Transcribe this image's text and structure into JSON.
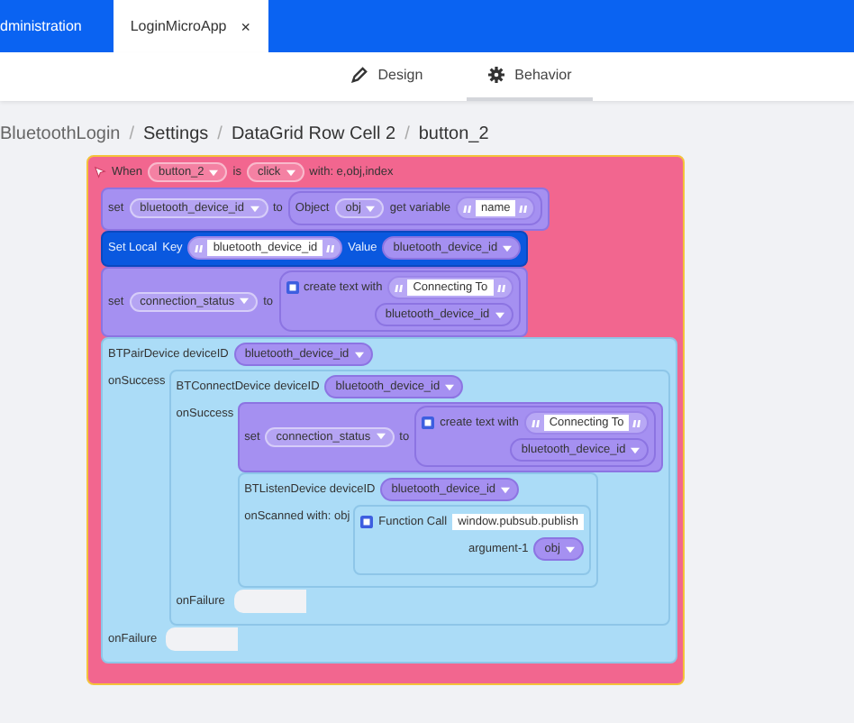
{
  "tabs": [
    {
      "label": "dministration",
      "selected": false
    },
    {
      "label": "LoginMicroApp",
      "selected": true,
      "close": "×"
    }
  ],
  "view_tabs": [
    {
      "label": "Design",
      "selected": false
    },
    {
      "label": "Behavior",
      "selected": true
    }
  ],
  "breadcrumb": {
    "separator": "/",
    "items": [
      "BluetoothLogin",
      "Settings",
      "DataGrid Row Cell 2",
      "button_2"
    ]
  },
  "workspace": {
    "blocks": [
      {
        "kind": "event",
        "selected": true,
        "rows": [
          {
            "parts": [
              {
                "kind": "label",
                "text": "When"
              },
              {
                "kind": "dropdown",
                "text": "button_2"
              },
              {
                "kind": "label",
                "text": "is"
              },
              {
                "kind": "dropdown",
                "text": "click"
              },
              {
                "kind": "label",
                "text": "with: e,obj,index"
              }
            ]
          },
          {
            "body": [
              {
                "kind": "variable",
                "rows": [
                  {
                    "parts": [
                      {
                        "kind": "label",
                        "text": "set"
                      },
                      {
                        "kind": "dropdown",
                        "text": "bluetooth_device_id"
                      },
                      {
                        "kind": "label",
                        "text": "to"
                      },
                      {
                        "kind": "value",
                        "block": {
                          "kind": "variable",
                          "rows": [
                            {
                              "parts": [
                                {
                                  "kind": "label",
                                  "text": "Object"
                                },
                                {
                                  "kind": "dropdown",
                                  "text": "obj"
                                },
                                {
                                  "kind": "label",
                                  "text": "get variable"
                                },
                                {
                                  "kind": "text",
                                  "text": "name"
                                }
                              ]
                            }
                          ]
                        }
                      }
                    ]
                  }
                ]
              },
              {
                "kind": "local",
                "rows": [
                  {
                    "parts": [
                      {
                        "kind": "label",
                        "text": "Set Local"
                      },
                      {
                        "kind": "label",
                        "text": "Key"
                      },
                      {
                        "kind": "text",
                        "text": "bluetooth_device_id"
                      },
                      {
                        "kind": "label",
                        "text": "Value"
                      },
                      {
                        "kind": "getter",
                        "text": "bluetooth_device_id"
                      }
                    ]
                  }
                ]
              },
              {
                "kind": "variable",
                "rows": [
                  {
                    "parts": [
                      {
                        "kind": "label",
                        "text": "set"
                      },
                      {
                        "kind": "dropdown",
                        "text": "connection_status"
                      },
                      {
                        "kind": "label",
                        "text": "to"
                      },
                      {
                        "kind": "value",
                        "block": {
                          "kind": "variable",
                          "rows": [
                            {
                              "parts": [
                                {
                                  "kind": "mutator"
                                },
                                {
                                  "kind": "label",
                                  "text": "create text with"
                                },
                                {
                                  "kind": "text",
                                  "text": "Connecting To"
                                }
                              ]
                            },
                            {
                              "parts": [
                                {
                                  "kind": "getter",
                                  "text": "bluetooth_device_id"
                                }
                              ]
                            }
                          ]
                        }
                      }
                    ]
                  }
                ]
              },
              {
                "kind": "api",
                "rows": [
                  {
                    "parts": [
                      {
                        "kind": "label",
                        "text": "BTPairDevice deviceID"
                      },
                      {
                        "kind": "getter",
                        "text": "bluetooth_device_id"
                      }
                    ]
                  },
                  {
                    "label": "onSuccess",
                    "body": [
                      {
                        "kind": "api",
                        "rows": [
                          {
                            "parts": [
                              {
                                "kind": "label",
                                "text": "BTConnectDevice deviceID"
                              },
                              {
                                "kind": "getter",
                                "text": "bluetooth_device_id"
                              }
                            ]
                          },
                          {
                            "label": "onSuccess",
                            "body": [
                              {
                                "kind": "variable",
                                "rows": [
                                  {
                                    "parts": [
                                      {
                                        "kind": "label",
                                        "text": "set"
                                      },
                                      {
                                        "kind": "dropdown",
                                        "text": "connection_status"
                                      },
                                      {
                                        "kind": "label",
                                        "text": "to"
                                      },
                                      {
                                        "kind": "value",
                                        "block": {
                                          "kind": "variable",
                                          "rows": [
                                            {
                                              "parts": [
                                                {
                                                  "kind": "mutator"
                                                },
                                                {
                                                  "kind": "label",
                                                  "text": "create text with"
                                                },
                                                {
                                                  "kind": "text",
                                                  "text": "Connecting To"
                                                }
                                              ]
                                            },
                                            {
                                              "parts": [
                                                {
                                                  "kind": "getter",
                                                  "text": "bluetooth_device_id"
                                                }
                                              ]
                                            }
                                          ]
                                        }
                                      }
                                    ]
                                  }
                                ]
                              },
                              {
                                "kind": "api",
                                "rows": [
                                  {
                                    "parts": [
                                      {
                                        "kind": "label",
                                        "text": "BTListenDevice deviceID"
                                      },
                                      {
                                        "kind": "getter",
                                        "text": "bluetooth_device_id"
                                      }
                                    ]
                                  },
                                  {
                                    "label": "onScanned with: obj",
                                    "body": [
                                      {
                                        "kind": "api",
                                        "rows": [
                                          {
                                            "parts": [
                                              {
                                                "kind": "mutator"
                                              },
                                              {
                                                "kind": "label",
                                                "text": "Function Call"
                                              },
                                              {
                                                "kind": "field",
                                                "text": "window.pubsub.publish"
                                              }
                                            ]
                                          },
                                          {
                                            "parts": [
                                              {
                                                "kind": "label",
                                                "text": "argument-1"
                                              },
                                              {
                                                "kind": "getter",
                                                "text": "obj"
                                              }
                                            ]
                                          }
                                        ]
                                      }
                                    ]
                                  }
                                ]
                              }
                            ]
                          },
                          {
                            "label": "onFailure"
                          }
                        ]
                      }
                    ]
                  },
                  {
                    "label": "onFailure"
                  }
                ]
              }
            ]
          }
        ]
      }
    ]
  }
}
